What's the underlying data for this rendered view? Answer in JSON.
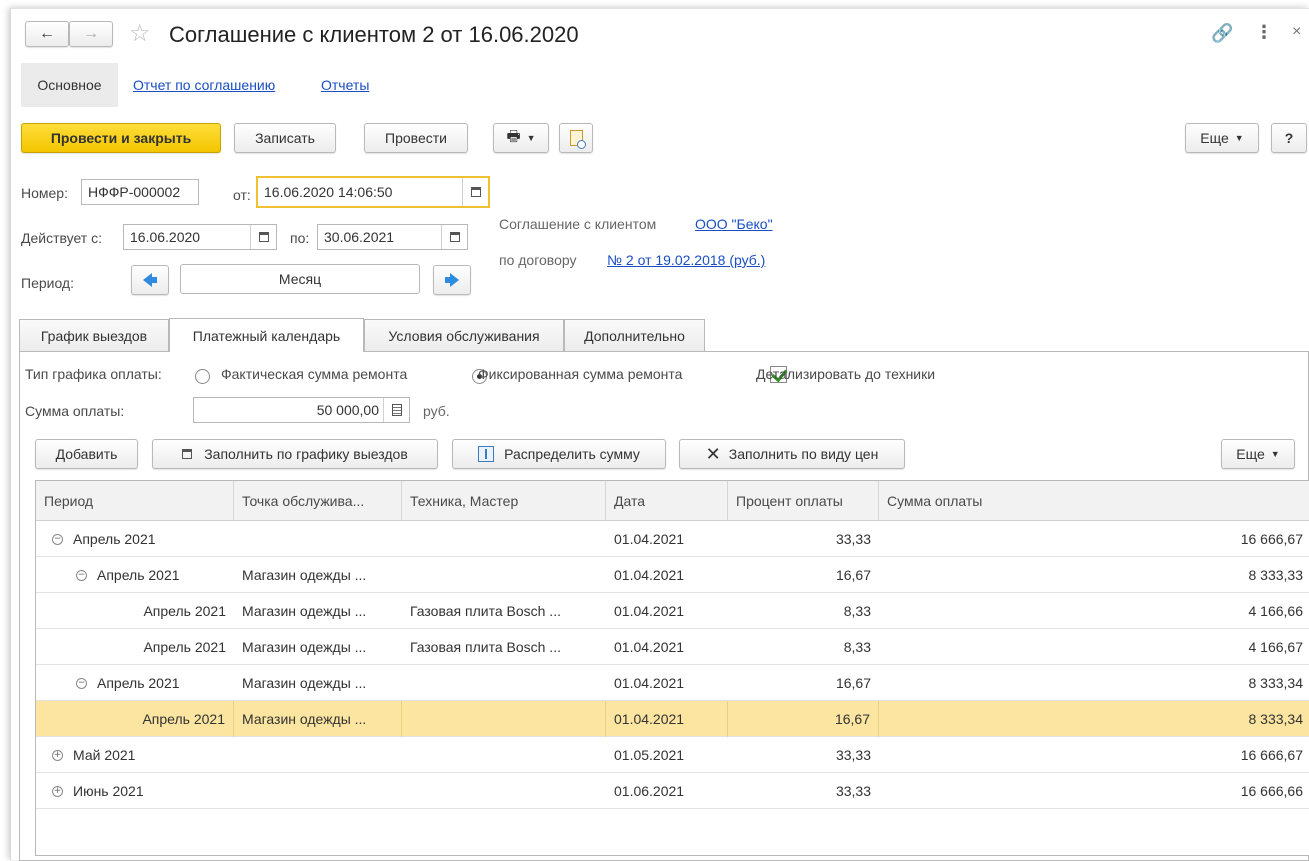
{
  "window": {
    "title": "Соглашение с клиентом 2 от 16.06.2020"
  },
  "nav_tabs": [
    "Основное",
    "Отчет по соглашению",
    "Отчеты"
  ],
  "toolbar": {
    "post_close": "Провести и закрыть",
    "save": "Записать",
    "post": "Провести",
    "more": "Еще",
    "help": "?"
  },
  "header": {
    "number_label": "Номер:",
    "number_value": "НФФР-000002",
    "from_label": "от:",
    "date_value": "16.06.2020 14:06:50",
    "valid_from_label": "Действует с:",
    "valid_from_value": "16.06.2020",
    "to_label": "по:",
    "valid_to_value": "30.06.2021",
    "period_label": "Период:",
    "period_value": "Месяц",
    "agreement_label": "Соглашение с клиентом",
    "agreement_link": "ООО \"Беко\"",
    "contract_label": "по договору",
    "contract_link": "№ 2 от 19.02.2018 (руб.)"
  },
  "tabs": [
    "График выездов",
    "Платежный календарь",
    "Условия обслуживания",
    "Дополнительно"
  ],
  "payment": {
    "type_label": "Тип графика оплаты:",
    "option_actual": "Фактическая сумма ремонта",
    "option_fixed": "Фиксированная сумма ремонта",
    "detail_label": "Детализировать до техники",
    "sum_label": "Сумма оплаты:",
    "sum_value": "50 000,00",
    "currency": "руб."
  },
  "table_toolbar": {
    "add": "Добавить",
    "fill_schedule": "Заполнить по графику выездов",
    "distribute": "Распределить сумму",
    "fill_price": "Заполнить по виду цен",
    "more": "Еще"
  },
  "table": {
    "columns": [
      "Период",
      "Точка обслужива...",
      "Техника, Мастер",
      "Дата",
      "Процент оплаты",
      "Сумма оплаты"
    ],
    "rows": [
      {
        "period": "Апрель 2021",
        "point": "",
        "tech": "",
        "date": "01.04.2021",
        "percent": "33,33",
        "sum": "16 666,67"
      },
      {
        "period": "Апрель 2021",
        "point": "Магазин одежды ...",
        "tech": "",
        "date": "01.04.2021",
        "percent": "16,67",
        "sum": "8 333,33"
      },
      {
        "period": "Апрель 2021",
        "point": "Магазин одежды ...",
        "tech": "Газовая плита Bosch ...",
        "date": "01.04.2021",
        "percent": "8,33",
        "sum": "4 166,66"
      },
      {
        "period": "Апрель 2021",
        "point": "Магазин одежды ...",
        "tech": "Газовая плита Bosch ...",
        "date": "01.04.2021",
        "percent": "8,33",
        "sum": "4 166,67"
      },
      {
        "period": "Апрель 2021",
        "point": "Магазин одежды ...",
        "tech": "",
        "date": "01.04.2021",
        "percent": "16,67",
        "sum": "8 333,34"
      },
      {
        "period": "Апрель 2021",
        "point": "Магазин одежды ...",
        "tech": "",
        "date": "01.04.2021",
        "percent": "16,67",
        "sum": "8 333,34"
      },
      {
        "period": "Май 2021",
        "point": "",
        "tech": "",
        "date": "01.05.2021",
        "percent": "33,33",
        "sum": "16 666,67"
      },
      {
        "period": "Июнь 2021",
        "point": "",
        "tech": "",
        "date": "01.06.2021",
        "percent": "33,33",
        "sum": "16 666,66"
      }
    ]
  },
  "colors": {
    "primary_button": "#f3c500",
    "selected_row": "#fbe5a0",
    "link": "#1a4ec4",
    "focus_border": "#f0c030"
  }
}
